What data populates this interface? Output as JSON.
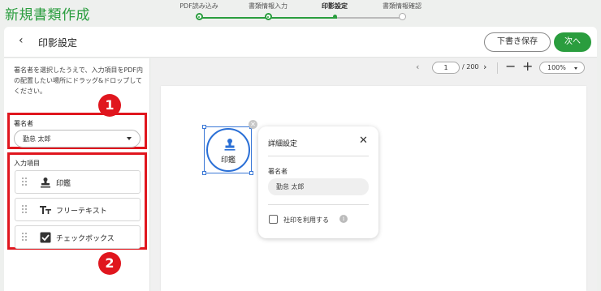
{
  "app": {
    "title": "新規書類作成"
  },
  "stepper": {
    "steps": [
      {
        "label": "PDF読み込み",
        "state": "done"
      },
      {
        "label": "書類情報入力",
        "state": "done"
      },
      {
        "label": "印影設定",
        "state": "current"
      },
      {
        "label": "書類情報確認",
        "state": "todo"
      }
    ]
  },
  "toolbar": {
    "title": "印影設定",
    "draft_label": "下書き保存",
    "next_label": "次へ"
  },
  "sidebar": {
    "instructions": "署名者を選択したうえで、入力項目をPDF内の配置したい場所にドラッグ&ドロップしてください。",
    "signer_label": "署名者",
    "signer_value": "勤怠 太郎",
    "fields_label": "入力項目",
    "items": [
      {
        "label": "印鑑",
        "icon": "stamp-icon"
      },
      {
        "label": "フリーテキスト",
        "icon": "text-icon"
      },
      {
        "label": "チェックボックス",
        "icon": "checkbox-icon"
      }
    ]
  },
  "annotations": {
    "badge1": "1",
    "badge2": "2"
  },
  "pager": {
    "current_page": "1",
    "total": "/ 200",
    "zoom": "100%"
  },
  "canvas": {
    "seal_label": "印鑑"
  },
  "popup": {
    "title": "詳細設定",
    "signer_label": "署名者",
    "signer_value": "勤怠 太郎",
    "checkbox_label": "社印を利用する",
    "info": "i"
  },
  "colors": {
    "accent_green": "#2a9d3e",
    "annotation_red": "#e0161e",
    "selection_blue": "#3a78d6"
  }
}
